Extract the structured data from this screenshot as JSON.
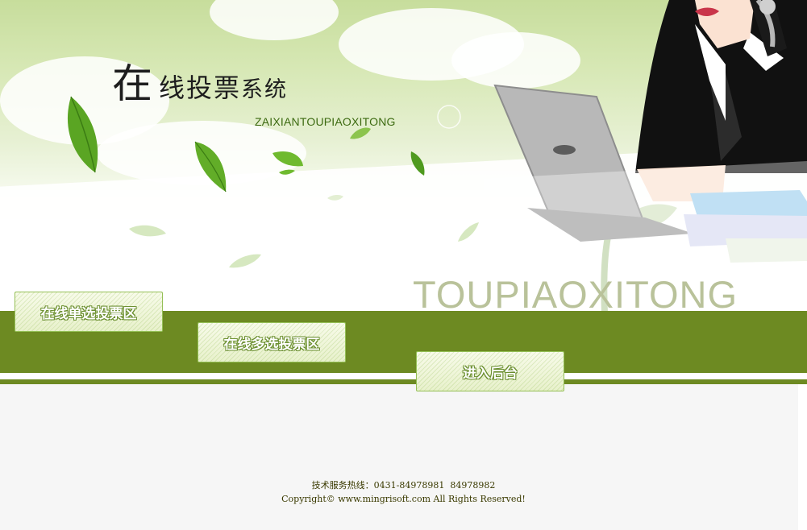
{
  "banner": {
    "title_big": "在",
    "title_rest_1": "线投票",
    "title_rest_2": "系统",
    "pinyin": "ZAIXIANTOUPIAOXITONG",
    "watermark": "TOUPIAOXITONG"
  },
  "nav": {
    "single_vote": "在线单选投票区",
    "multi_vote": "在线多选投票区",
    "admin": "进入后台"
  },
  "footer": {
    "hotline": "技术服务热线：0431-84978981  84978982",
    "copyright": "Copyright© www.mingrisoft.com All Rights Reserved!"
  },
  "colors": {
    "band": "#6d8a22",
    "button_border": "#94bf55",
    "button_text_outline": "#6a8e2e"
  }
}
